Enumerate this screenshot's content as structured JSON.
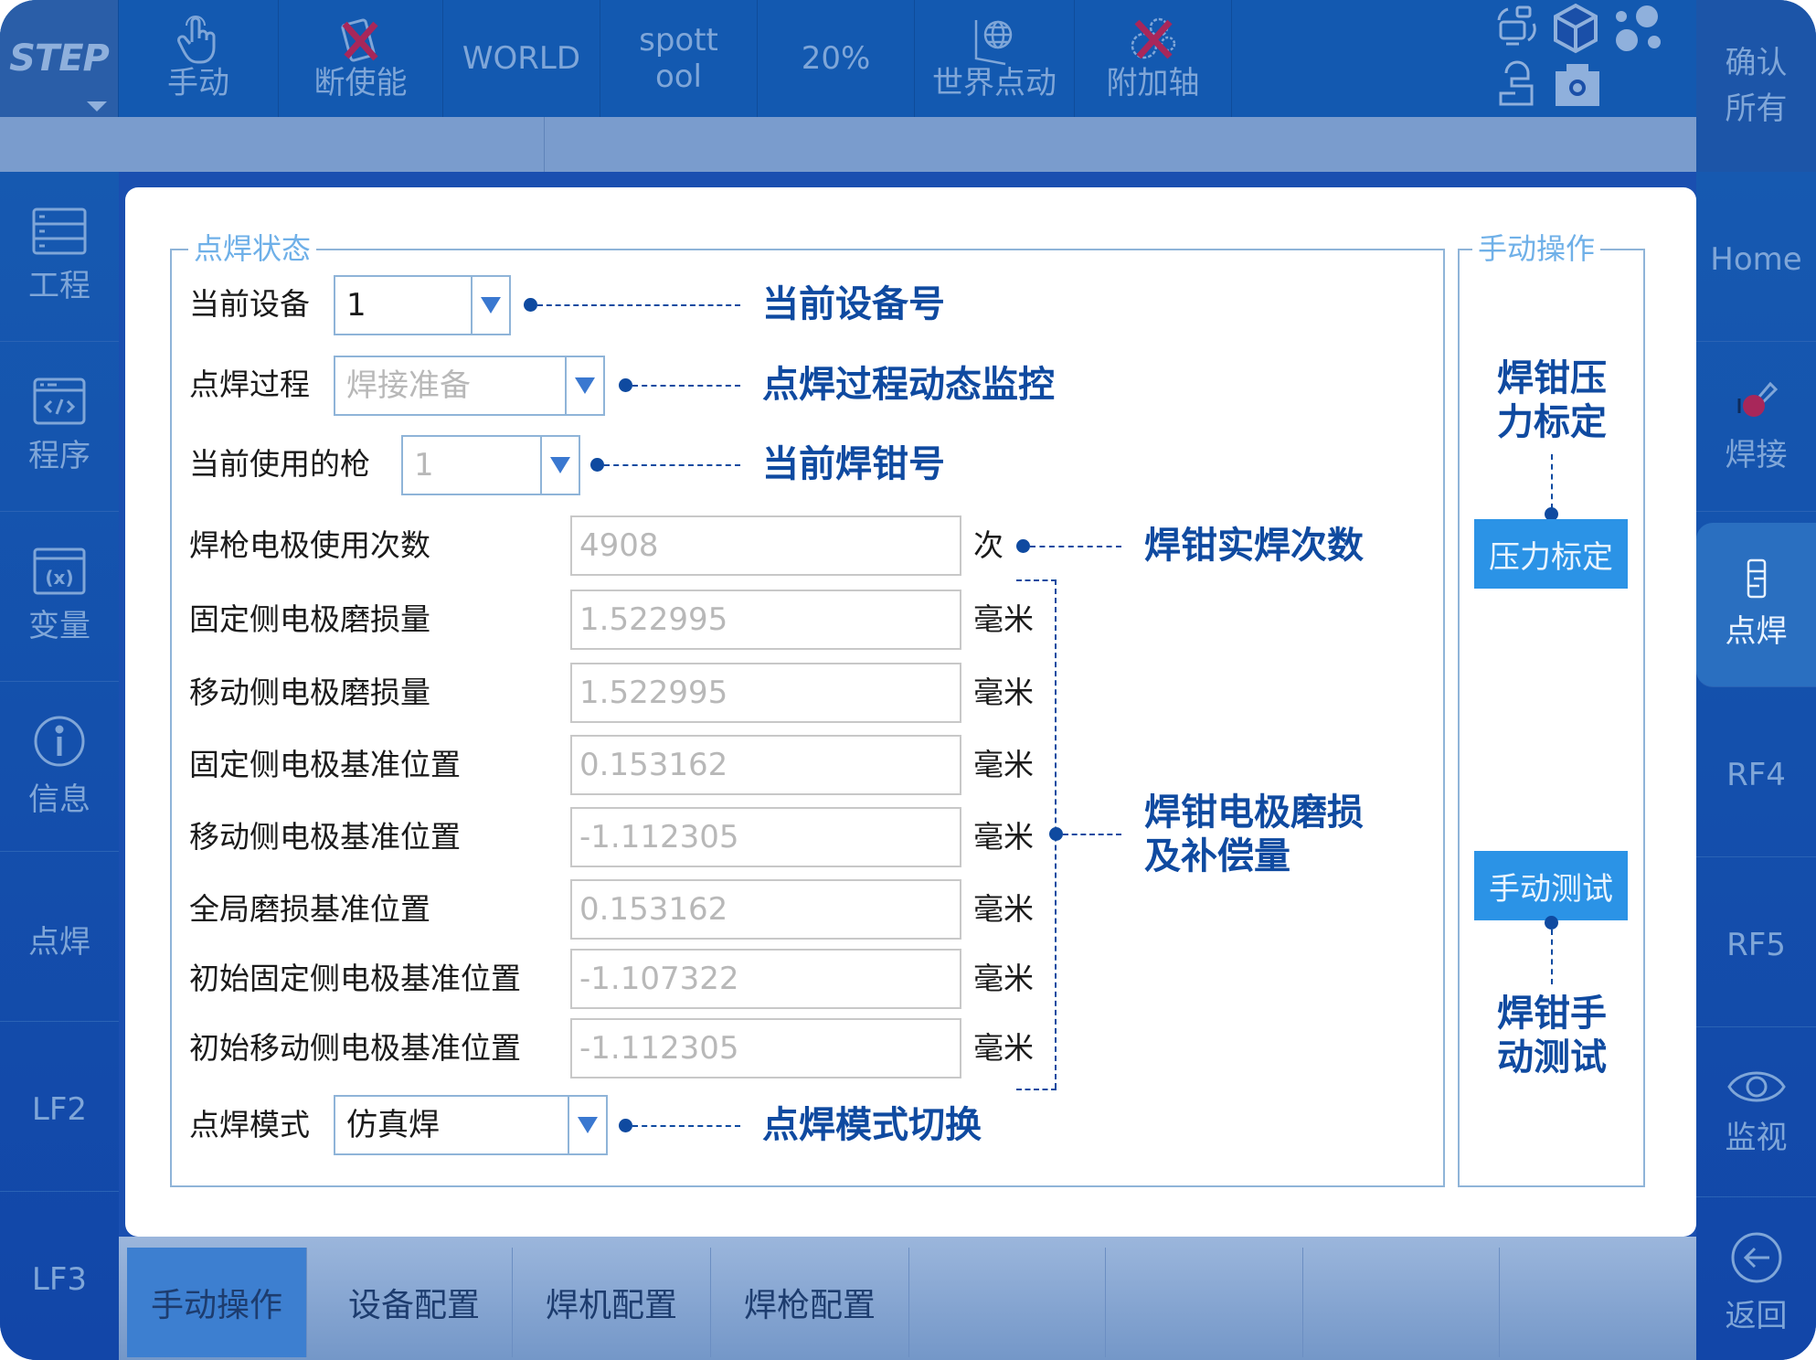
{
  "topbar": {
    "mode": "STEP",
    "items": [
      {
        "label": "手动",
        "icon": "hand-pointer-icon"
      },
      {
        "label": "断使能",
        "icon": "servo-disabled-icon"
      },
      {
        "label": "WORLD"
      },
      {
        "label": "spott\nool"
      },
      {
        "label": "20%"
      },
      {
        "label": "世界点动",
        "icon": "world-jog-icon"
      },
      {
        "label": "附加轴",
        "icon": "external-axis-disabled-icon"
      }
    ],
    "status_icons": [
      "robot-connect-icon",
      "cube-icon",
      "dots-icon",
      "operator-icon",
      "camera-icon"
    ],
    "confirm_all": "确认\n所有"
  },
  "left_sidebar": [
    {
      "label": "工程",
      "icon": "project-list-icon"
    },
    {
      "label": "程序",
      "icon": "program-code-icon"
    },
    {
      "label": "变量",
      "icon": "variable-icon"
    },
    {
      "label": "信息",
      "icon": "info-icon"
    },
    {
      "label": "点焊"
    },
    {
      "label": "LF2"
    },
    {
      "label": "LF3"
    }
  ],
  "right_sidebar": [
    {
      "label": "Home"
    },
    {
      "label": "焊接",
      "icon": "welding-torch-icon"
    },
    {
      "label": "点焊",
      "icon": "spot-weld-gun-icon",
      "active": true
    },
    {
      "label": "RF4"
    },
    {
      "label": "RF5"
    },
    {
      "label": "监视",
      "icon": "eye-icon"
    },
    {
      "label": "返回",
      "icon": "back-arrow-icon"
    }
  ],
  "spot_weld_status": {
    "title": "点焊状态",
    "current_device": {
      "label": "当前设备",
      "value": "1"
    },
    "weld_process": {
      "label": "点焊过程",
      "value": "焊接准备"
    },
    "current_gun": {
      "label": "当前使用的枪",
      "value": "1"
    },
    "fields": [
      {
        "label": "焊枪电极使用次数",
        "value": "4908",
        "unit": "次"
      },
      {
        "label": "固定侧电极磨损量",
        "value": "1.522995",
        "unit": "毫米"
      },
      {
        "label": "移动侧电极磨损量",
        "value": "1.522995",
        "unit": "毫米"
      },
      {
        "label": "固定侧电极基准位置",
        "value": "0.153162",
        "unit": "毫米"
      },
      {
        "label": "移动侧电极基准位置",
        "value": "-1.112305",
        "unit": "毫米"
      },
      {
        "label": "全局磨损基准位置",
        "value": "0.153162",
        "unit": "毫米"
      },
      {
        "label": "初始固定侧电极基准位置",
        "value": "-1.107322",
        "unit": "毫米"
      },
      {
        "label": "初始移动侧电极基准位置",
        "value": "-1.112305",
        "unit": "毫米"
      }
    ],
    "weld_mode": {
      "label": "点焊模式",
      "value": "仿真焊"
    }
  },
  "manual_ops": {
    "title": "手动操作",
    "pressure_calibration_button": "压力标定",
    "manual_test_button": "手动测试"
  },
  "callouts": {
    "current_device_no": "当前设备号",
    "process_monitor": "点焊过程动态监控",
    "current_gun_no": "当前焊钳号",
    "weld_count": "焊钳实焊次数",
    "electrode_wear": "焊钳电极磨损\n及补偿量",
    "mode_switch": "点焊模式切换",
    "pressure_calibration": "焊钳压\n力标定",
    "manual_test": "焊钳手\n动测试"
  },
  "bottom_tabs": [
    {
      "label": "手动操作",
      "active": true
    },
    {
      "label": "设备配置"
    },
    {
      "label": "焊机配置"
    },
    {
      "label": "焊枪配置"
    },
    {
      "label": ""
    },
    {
      "label": ""
    },
    {
      "label": ""
    },
    {
      "label": ""
    }
  ],
  "colors": {
    "callout": "#0f4aa0",
    "action_button": "#2b93e6",
    "disabled_x": "#a8275a"
  }
}
